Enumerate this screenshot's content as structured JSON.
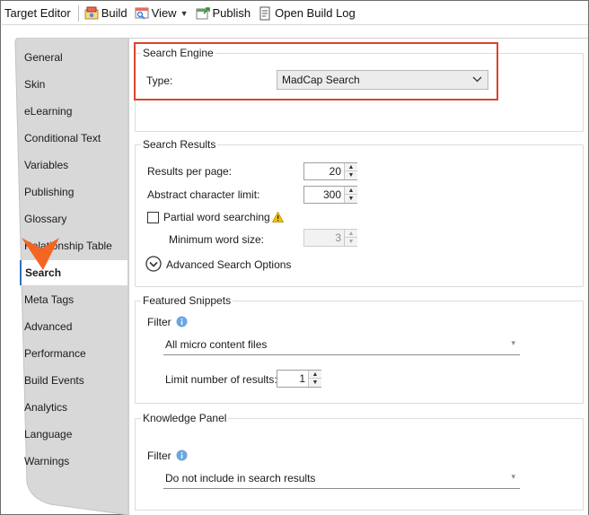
{
  "toolbar": {
    "title": "Target Editor",
    "build": "Build",
    "view": "View",
    "publish": "Publish",
    "open_build_log": "Open Build Log"
  },
  "tabs": [
    {
      "label": "General"
    },
    {
      "label": "Skin"
    },
    {
      "label": "eLearning"
    },
    {
      "label": "Conditional Text"
    },
    {
      "label": "Variables"
    },
    {
      "label": "Publishing"
    },
    {
      "label": "Glossary"
    },
    {
      "label": "Relationship Table"
    },
    {
      "label": "Search",
      "active": true
    },
    {
      "label": "Meta Tags"
    },
    {
      "label": "Advanced"
    },
    {
      "label": "Performance"
    },
    {
      "label": "Build Events"
    },
    {
      "label": "Analytics"
    },
    {
      "label": "Language"
    },
    {
      "label": "Warnings"
    }
  ],
  "search_engine": {
    "title": "Search Engine",
    "type_label": "Type:",
    "type_value": "MadCap Search"
  },
  "search_results": {
    "title": "Search Results",
    "results_per_page_label": "Results per page:",
    "results_per_page": "20",
    "abstract_limit_label": "Abstract character limit:",
    "abstract_limit": "300",
    "partial_word_label": "Partial word searching",
    "partial_word_checked": false,
    "min_word_size_label": "Minimum word size:",
    "min_word_size": "3",
    "advanced_options_label": "Advanced Search Options"
  },
  "featured_snippets": {
    "title": "Featured Snippets",
    "filter_label": "Filter",
    "filter_value": "All micro content files",
    "limit_label": "Limit number of results:",
    "limit_value": "1"
  },
  "knowledge_panel": {
    "title": "Knowledge Panel",
    "filter_label": "Filter",
    "filter_value": "Do not include in search results"
  },
  "colors": {
    "highlight": "#d9442f",
    "callout": "#f26522",
    "tab_strip": "#d8d8d8",
    "info_icon": "#6aa6e0",
    "warning_icon": "#f2c200"
  }
}
